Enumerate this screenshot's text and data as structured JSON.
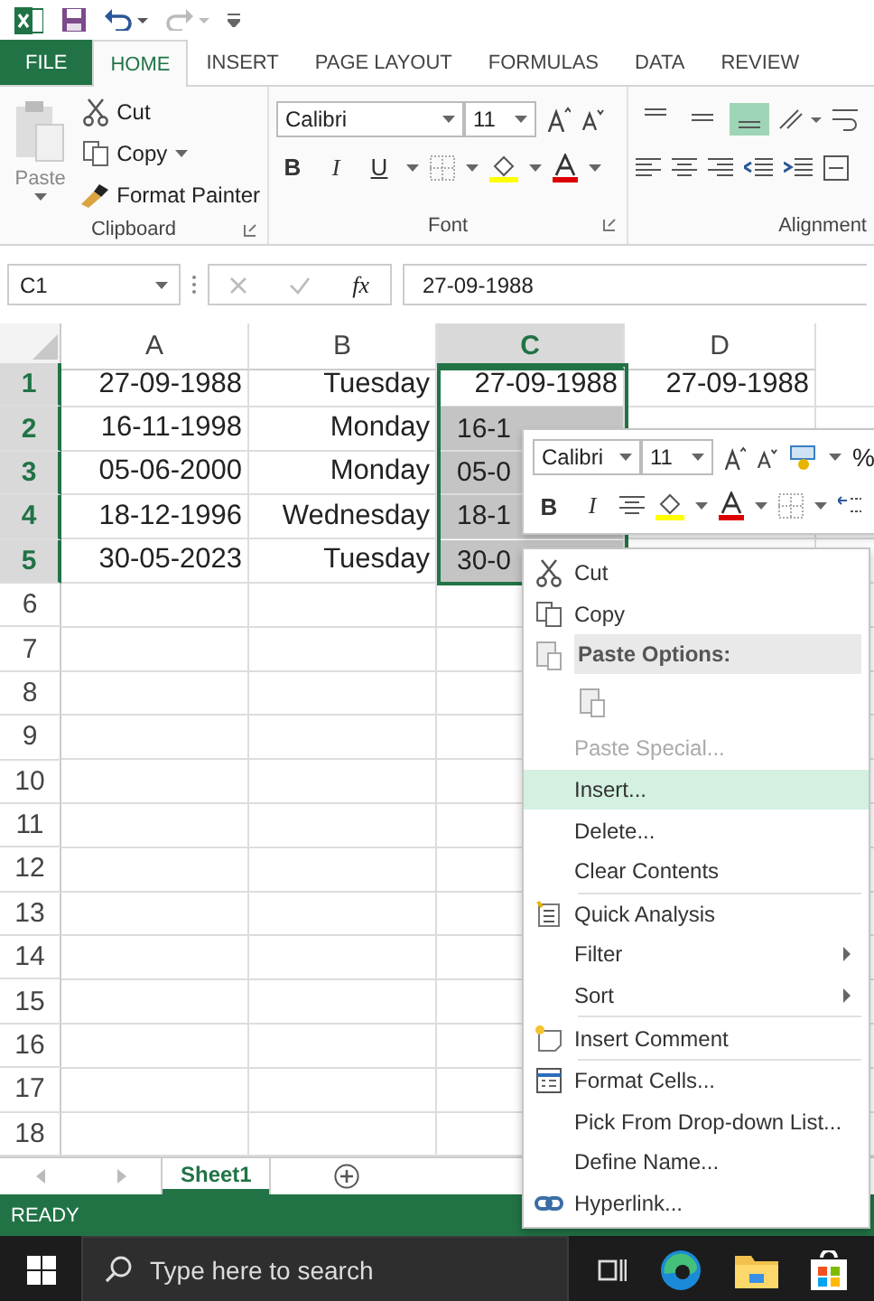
{
  "tabs": [
    {
      "label": "FILE",
      "kind": "file",
      "selected": false
    },
    {
      "label": "HOME",
      "kind": "tab",
      "selected": true
    },
    {
      "label": "INSERT",
      "kind": "tab",
      "selected": false
    },
    {
      "label": "PAGE LAYOUT",
      "kind": "tab",
      "selected": false
    },
    {
      "label": "FORMULAS",
      "kind": "tab",
      "selected": false
    },
    {
      "label": "DATA",
      "kind": "tab",
      "selected": false
    },
    {
      "label": "REVIEW",
      "kind": "tab",
      "selected": false
    }
  ],
  "clipboard": {
    "paste": "Paste",
    "cut": "Cut",
    "copy": "Copy",
    "format_painter": "Format Painter",
    "label": "Clipboard"
  },
  "font": {
    "name": "Calibri",
    "size": "11",
    "bold": "B",
    "italic": "I",
    "underline": "U",
    "label": "Font"
  },
  "alignment": {
    "label": "Alignment",
    "vertical": [
      {
        "selected": false
      },
      {
        "selected": false
      },
      {
        "selected": true
      }
    ]
  },
  "formula_bar": {
    "name_box": "C1",
    "fx": "fx",
    "formula": "27-09-1988"
  },
  "sheet": {
    "columns": [
      {
        "label": "A",
        "selected": false
      },
      {
        "label": "B",
        "selected": false
      },
      {
        "label": "C",
        "selected": true
      },
      {
        "label": "D",
        "selected": false
      }
    ],
    "rows": [
      {
        "header": "1",
        "selected": true,
        "cells": [
          {
            "value": "27-09-1988",
            "selected": false
          },
          {
            "value": "Tuesday",
            "selected": false
          },
          {
            "value": "27-09-1988",
            "selected": false
          },
          {
            "value": "27-09-1988",
            "selected": false
          }
        ]
      },
      {
        "header": "2",
        "selected": true,
        "cells": [
          {
            "value": "16-11-1998",
            "selected": false
          },
          {
            "value": "Monday",
            "selected": false
          },
          {
            "value": "16-1",
            "selected": true
          }
        ]
      },
      {
        "header": "3",
        "selected": true,
        "cells": [
          {
            "value": "05-06-2000",
            "selected": false
          },
          {
            "value": "Monday",
            "selected": false
          },
          {
            "value": "05-0",
            "selected": true
          }
        ]
      },
      {
        "header": "4",
        "selected": true,
        "cells": [
          {
            "value": "18-12-1996",
            "selected": false
          },
          {
            "value": "Wednesday",
            "selected": false
          },
          {
            "value": "18-1",
            "selected": true
          }
        ]
      },
      {
        "header": "5",
        "selected": true,
        "cells": [
          {
            "value": "30-05-2023",
            "selected": false
          },
          {
            "value": "Tuesday",
            "selected": false
          },
          {
            "value": "30-0",
            "selected": true
          }
        ]
      },
      {
        "header": "6",
        "selected": false
      },
      {
        "header": "7",
        "selected": false
      },
      {
        "header": "8",
        "selected": false
      },
      {
        "header": "9",
        "selected": false
      },
      {
        "header": "10",
        "selected": false
      },
      {
        "header": "11",
        "selected": false
      },
      {
        "header": "12",
        "selected": false
      },
      {
        "header": "13",
        "selected": false
      },
      {
        "header": "14",
        "selected": false
      },
      {
        "header": "15",
        "selected": false
      },
      {
        "header": "16",
        "selected": false
      },
      {
        "header": "17",
        "selected": false
      },
      {
        "header": "18",
        "selected": false
      }
    ]
  },
  "mini_toolbar": {
    "font": "Calibri",
    "size": "11",
    "percent": "%",
    "bold": "B",
    "italic": "I"
  },
  "context_menu": [
    {
      "kind": "item",
      "label": "Cut",
      "selected": false,
      "disabled": false,
      "submenu": false
    },
    {
      "kind": "item",
      "label": "Copy",
      "selected": false,
      "disabled": false,
      "submenu": false
    },
    {
      "kind": "header",
      "label": "Paste Options:"
    },
    {
      "kind": "paste-options"
    },
    {
      "kind": "item",
      "label": "Paste Special...",
      "selected": false,
      "disabled": true,
      "submenu": false
    },
    {
      "kind": "item",
      "label": "Insert...",
      "selected": true,
      "disabled": false,
      "submenu": false
    },
    {
      "kind": "item",
      "label": "Delete...",
      "selected": false,
      "disabled": false,
      "submenu": false
    },
    {
      "kind": "item",
      "label": "Clear Contents",
      "selected": false,
      "disabled": false,
      "submenu": false
    },
    {
      "kind": "separator"
    },
    {
      "kind": "item",
      "label": "Quick Analysis",
      "selected": false,
      "disabled": false,
      "submenu": false
    },
    {
      "kind": "item",
      "label": "Filter",
      "selected": false,
      "disabled": false,
      "submenu": true
    },
    {
      "kind": "item",
      "label": "Sort",
      "selected": false,
      "disabled": false,
      "submenu": true
    },
    {
      "kind": "separator"
    },
    {
      "kind": "item",
      "label": "Insert Comment",
      "selected": false,
      "disabled": false,
      "submenu": false
    },
    {
      "kind": "separator"
    },
    {
      "kind": "item",
      "label": "Format Cells...",
      "selected": false,
      "disabled": false,
      "submenu": false
    },
    {
      "kind": "item",
      "label": "Pick From Drop-down List...",
      "selected": false,
      "disabled": false,
      "submenu": false
    },
    {
      "kind": "item",
      "label": "Define Name...",
      "selected": false,
      "disabled": false,
      "submenu": false
    },
    {
      "kind": "item",
      "label": "Hyperlink...",
      "selected": false,
      "disabled": false,
      "submenu": false
    }
  ],
  "sheet_tabs": [
    {
      "label": "Sheet1",
      "selected": true
    }
  ],
  "status_bar": {
    "text": "READY"
  },
  "taskbar": {
    "search": {
      "placeholder": "Type here to search"
    }
  }
}
